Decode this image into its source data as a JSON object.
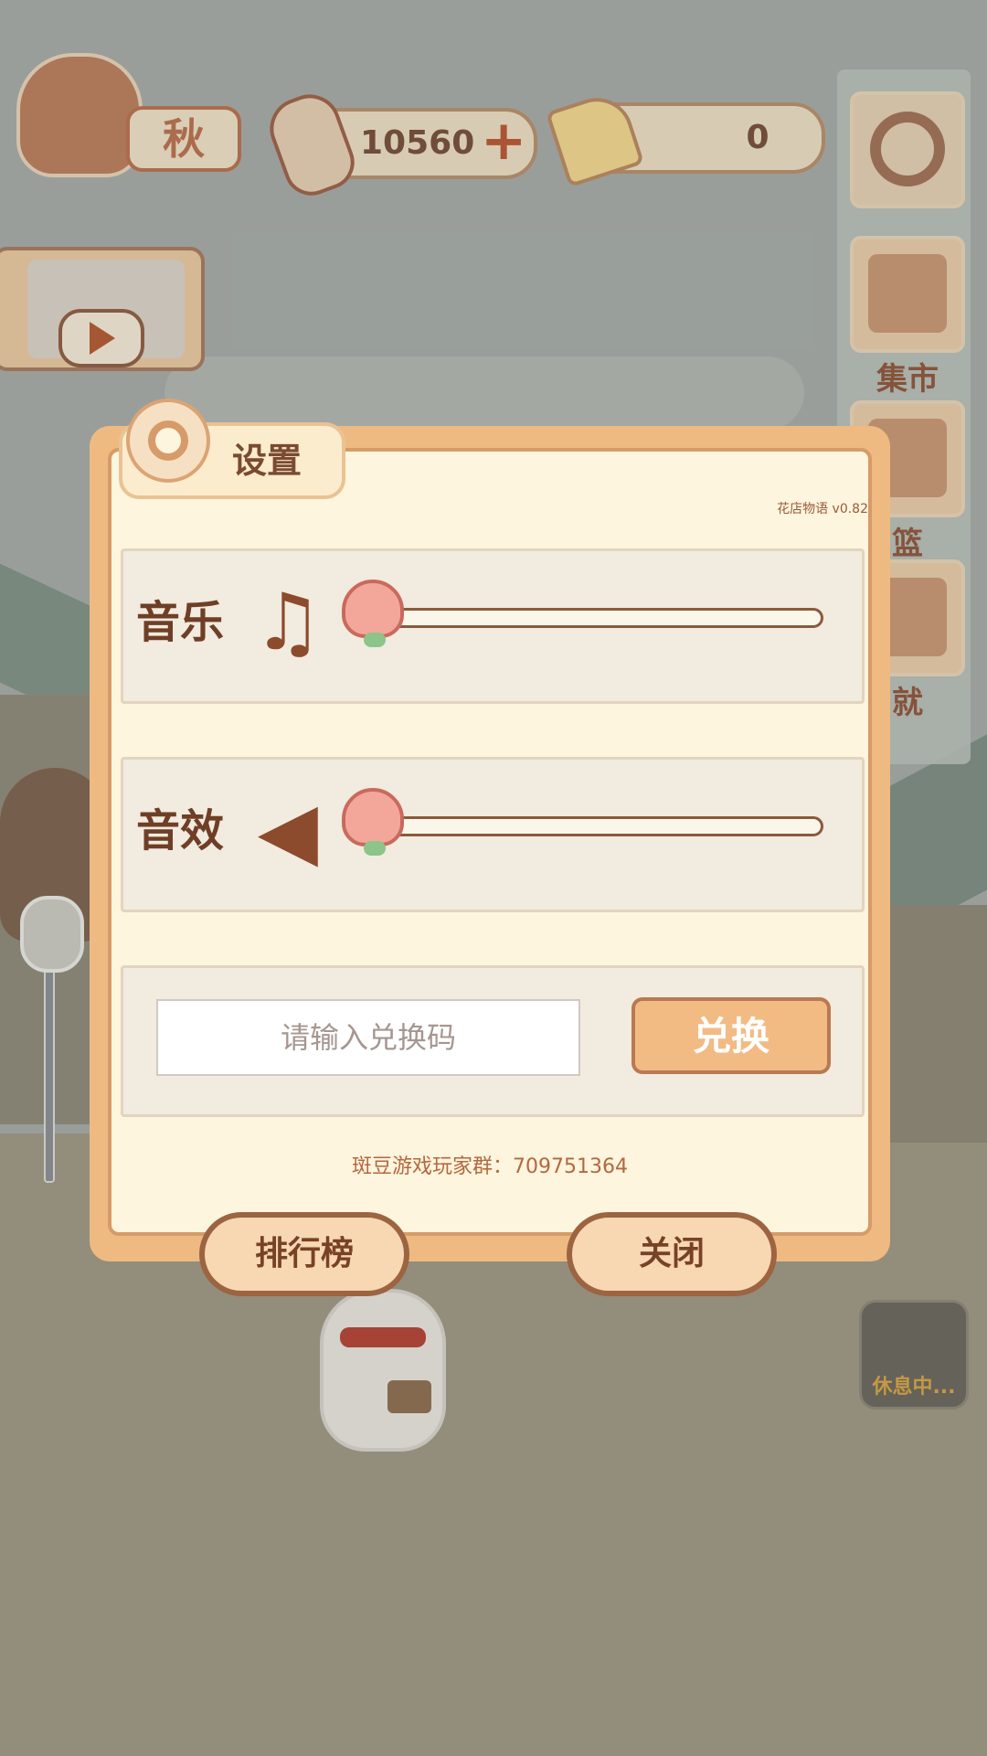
{
  "hud": {
    "season_label": "秋",
    "fish_value": "10560",
    "plus_symbol": "+",
    "cheese_value": "0"
  },
  "side_menu": {
    "market_label": "集市",
    "basket_label": "篮",
    "achieve_label": "就"
  },
  "mouse_status": "休息中...",
  "dialog": {
    "title": "设置",
    "version": "花店物语 v0.82",
    "music_label": "音乐",
    "music_icon": "♫",
    "sfx_label": "音效",
    "sfx_icon": "◀",
    "redeem_placeholder": "请输入兑换码",
    "redeem_button": "兑换",
    "player_group": "斑豆游戏玩家群：709751364",
    "rank_button": "排行榜",
    "close_button": "关闭"
  },
  "sliders": {
    "music_level": 0.05,
    "sfx_level": 0.05
  },
  "colors": {
    "dialog_bg": "#fdf5dd",
    "dialog_border": "#efba82",
    "accent_brown": "#8a5a3c",
    "button_orange": "#f2bb84"
  }
}
